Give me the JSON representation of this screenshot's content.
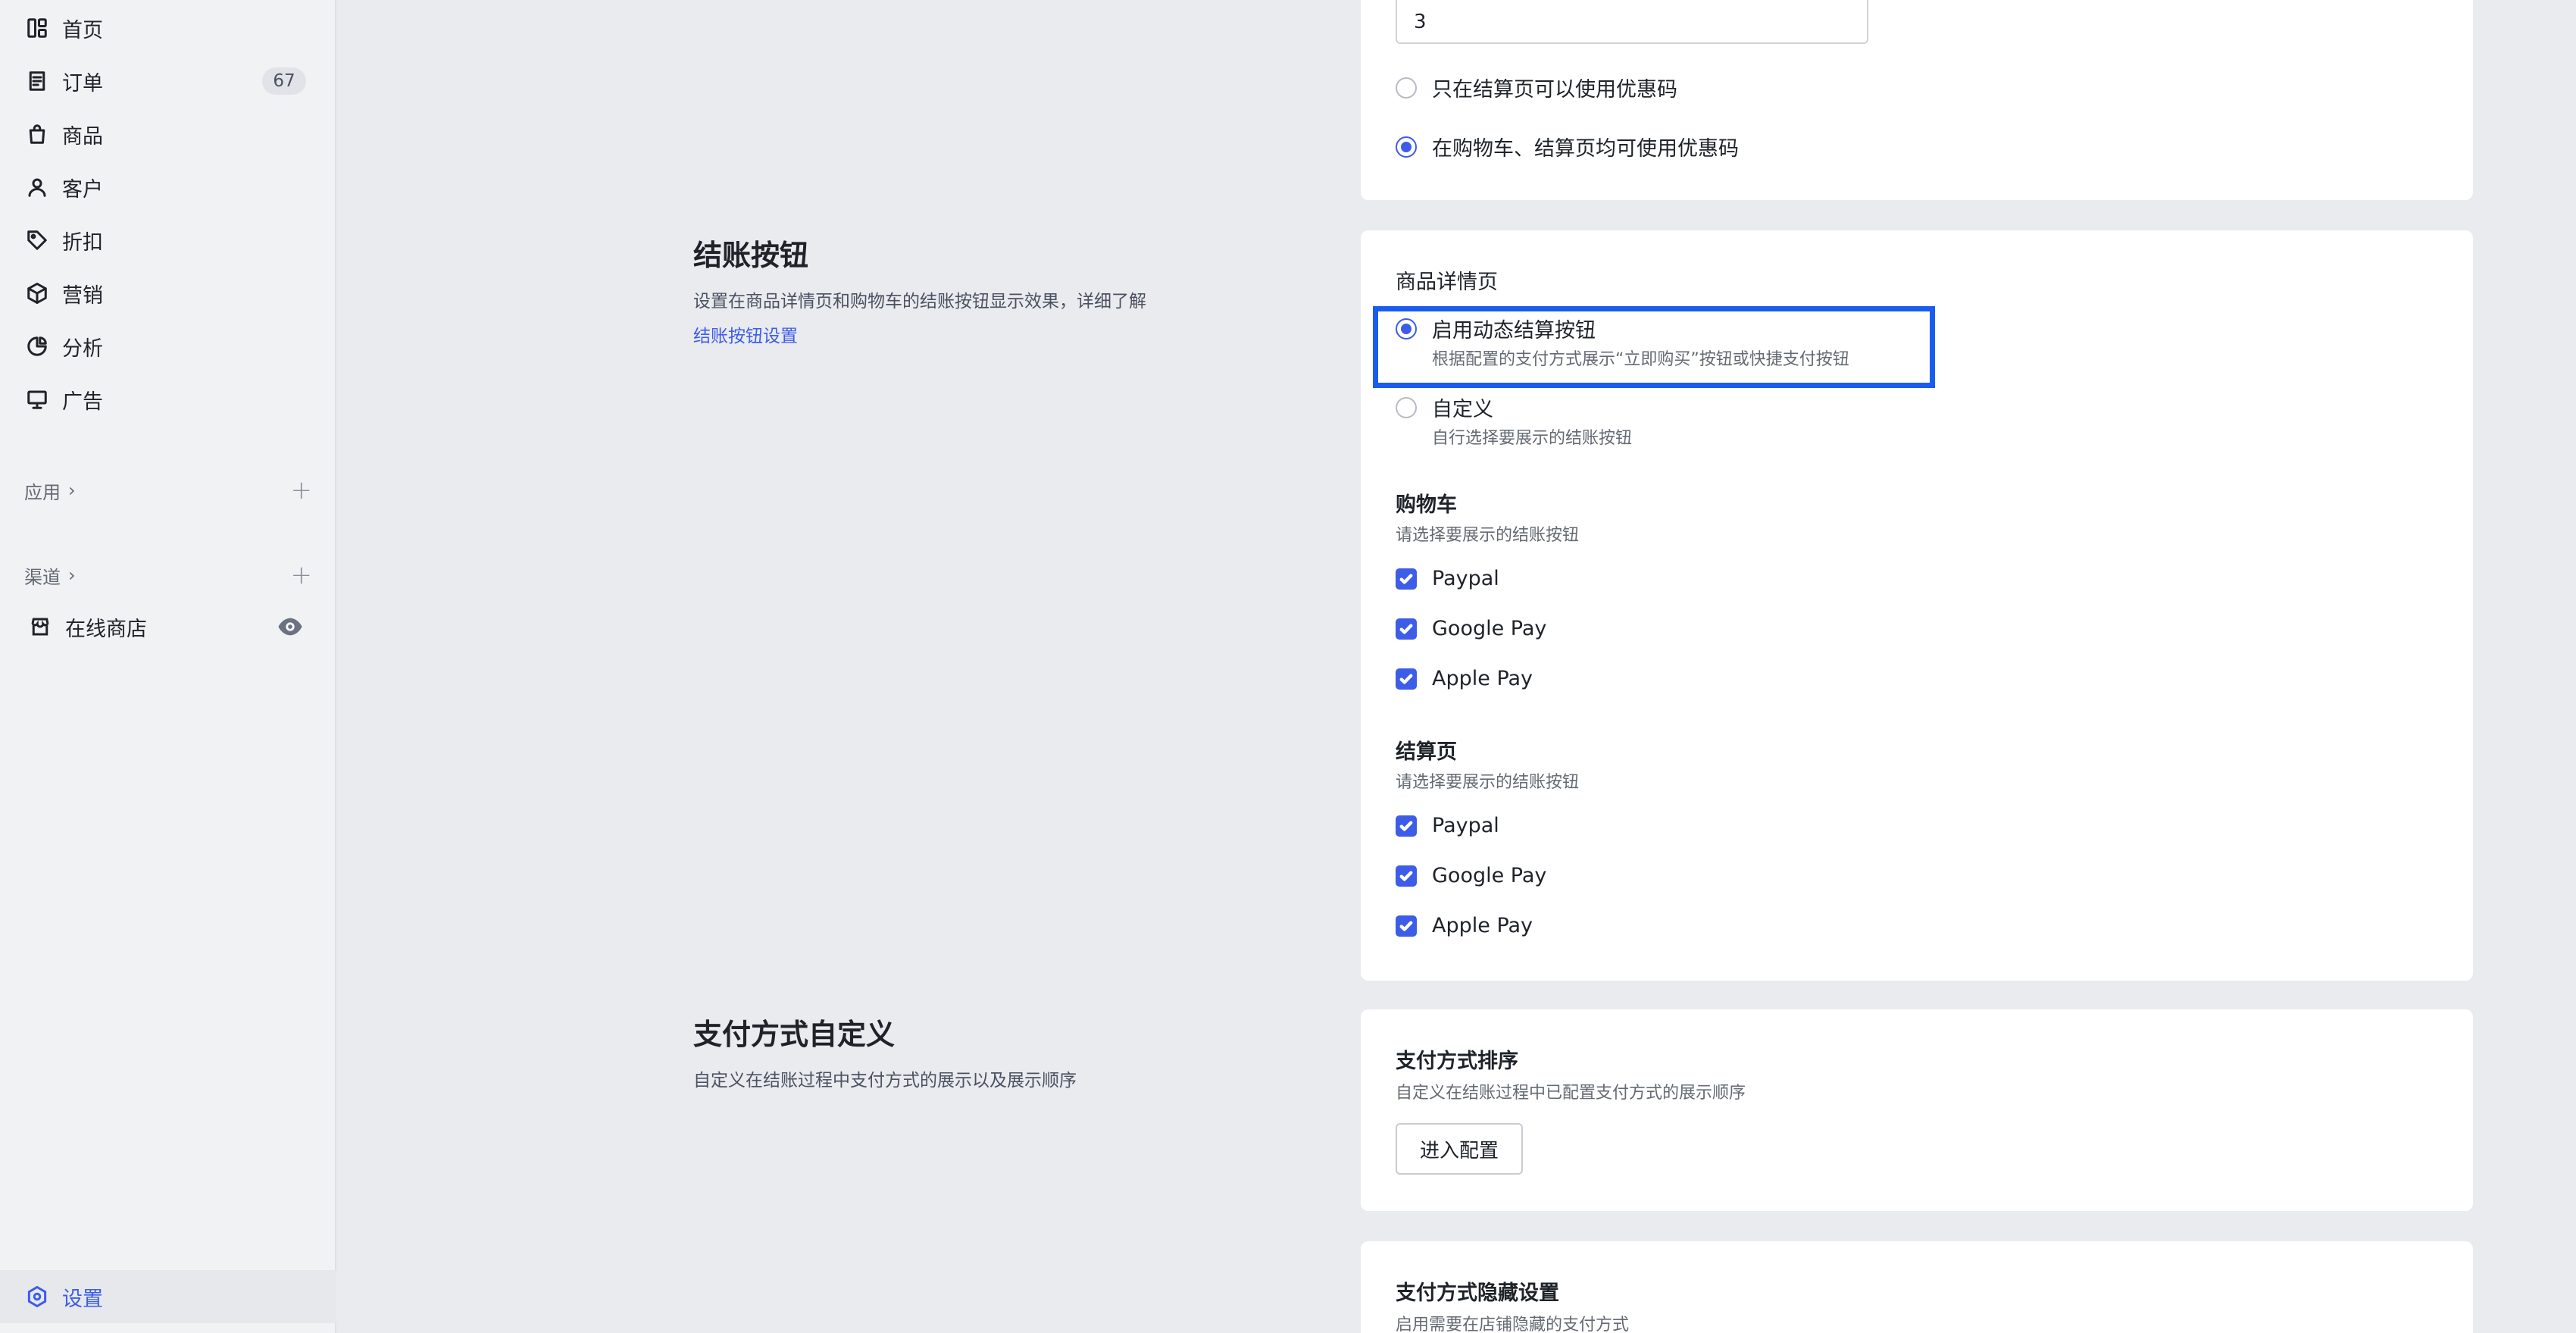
{
  "sidebar": {
    "nav": [
      {
        "label": "首页",
        "icon": "home-icon"
      },
      {
        "label": "订单",
        "icon": "order-icon",
        "badge": "67"
      },
      {
        "label": "商品",
        "icon": "bag-icon"
      },
      {
        "label": "客户",
        "icon": "user-icon"
      },
      {
        "label": "折扣",
        "icon": "tag-icon"
      },
      {
        "label": "营销",
        "icon": "box-icon"
      },
      {
        "label": "分析",
        "icon": "pie-chart-icon"
      },
      {
        "label": "广告",
        "icon": "billboard-icon"
      }
    ],
    "apps_label": "应用",
    "channels_label": "渠道",
    "online_store": "在线商店",
    "settings_label": "设置"
  },
  "coupon": {
    "input_value": "3",
    "option_checkout_only": "只在结算页可以使用优惠码",
    "option_cart_and_checkout": "在购物车、结算页均可使用优惠码"
  },
  "checkout_button": {
    "title": "结账按钮",
    "desc": "设置在商品详情页和购物车的结账按钮显示效果，详细了解",
    "link": "结账按钮设置",
    "product_page_title": "商品详情页",
    "dynamic_label": "启用动态结算按钮",
    "dynamic_desc": "根据配置的支付方式展示“立即购买”按钮或快捷支付按钮",
    "custom_label": "自定义",
    "custom_desc": "自行选择要展示的结账按钮",
    "cart_title": "购物车",
    "cart_desc": "请选择要展示的结账按钮",
    "cart_options": [
      "Paypal",
      "Google Pay",
      "Apple Pay"
    ],
    "checkout_title": "结算页",
    "checkout_desc": "请选择要展示的结账按钮",
    "checkout_options": [
      "Paypal",
      "Google Pay",
      "Apple Pay"
    ]
  },
  "payment_custom": {
    "title": "支付方式自定义",
    "desc": "自定义在结账过程中支付方式的展示以及展示顺序",
    "sort_title": "支付方式排序",
    "sort_desc": "自定义在结账过程中已配置支付方式的展示顺序",
    "config_button": "进入配置",
    "hide_title": "支付方式隐藏设置",
    "hide_desc": "启用需要在店铺隐藏的支付方式"
  },
  "colors": {
    "accent": "#3d5ce8",
    "highlight": "#1a5cf0"
  }
}
